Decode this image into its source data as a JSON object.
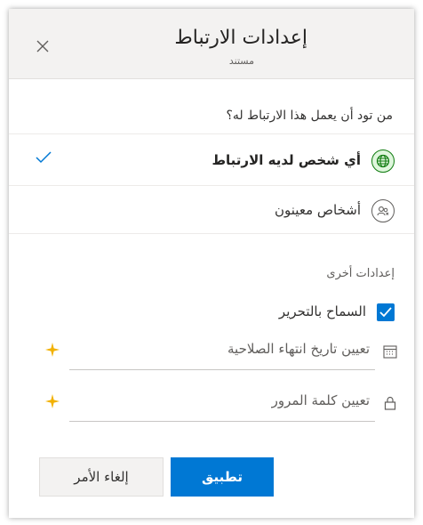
{
  "dialog": {
    "title": "إعدادات الارتباط",
    "subtitle": "مستند"
  },
  "question": "من تود أن يعمل هذا الارتباط له؟",
  "options": [
    {
      "label": "أي شخص لديه الارتباط",
      "icon": "globe-icon",
      "selected": true
    },
    {
      "label": "أشخاص معينون",
      "icon": "people-icon",
      "selected": false
    }
  ],
  "other_settings": {
    "label": "إعدادات أخرى",
    "allow_edit": {
      "label": "السماح بالتحرير",
      "checked": true
    },
    "expiration": {
      "label": "تعيين تاريخ انتهاء الصلاحية",
      "icon": "calendar-icon",
      "badge_icon": "sparkle-icon"
    },
    "password": {
      "label": "تعيين كلمة المرور",
      "icon": "lock-icon",
      "badge_icon": "sparkle-icon"
    }
  },
  "buttons": {
    "apply": "تطبيق",
    "cancel": "إلغاء الأمر"
  },
  "colors": {
    "accent": "#0078d4",
    "globe_bg": "#dff6dd",
    "globe_fg": "#107c10",
    "sparkle": "#f2b100"
  }
}
